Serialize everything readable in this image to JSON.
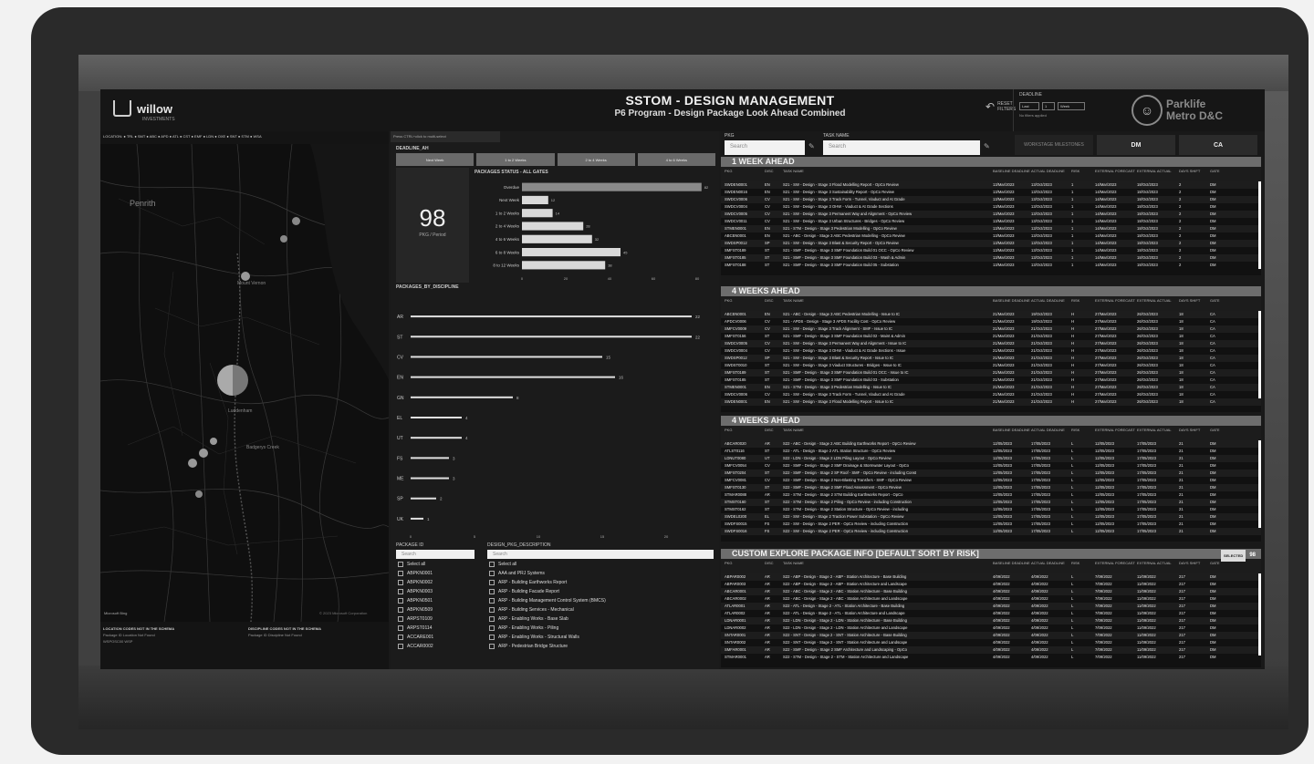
{
  "header": {
    "logo_text": "willow",
    "logo_sub": "INVESTMENTS",
    "title": "SSTOM - DESIGN MANAGEMENT",
    "subtitle": "P6 Program - Design Package Look Ahead Combined",
    "reset_label": "RESET FILTERS",
    "deadline_label": "DEADLINE",
    "deadline_opts": [
      "Last",
      "1",
      "Week"
    ],
    "no_filter_label": "No filters applied",
    "brand_line1": "Parklife",
    "brand_line2": "Metro D&C"
  },
  "map": {
    "legend": "LOCATION: ● TRL ● SMT ● ABC ● APD ● ATL ● CST ● EMF ● LDN ● OXE ● SNT ● STM ● WSA",
    "place1": "Penrith",
    "place2": "Luddenham",
    "place3": "Mount Vernon",
    "place4": "Badgerys Creek",
    "attribution": "© 2023 Microsoft Corporation",
    "bing": "Microsoft Bing",
    "bottom_left_title": "LOCATION CODES NOT IN THE SCHEMA",
    "bottom_left_row": "Package ID    Location Not Found",
    "bottom_left_row2": "WSPOSC00    WSP",
    "bottom_right_title": "DISCIPLINE CODES NOT IN THE SCHEMA",
    "bottom_right_row": "Package ID    Discipline Not Found"
  },
  "mid": {
    "tab": "Press CTRL+click to multi-select",
    "deadline_title": "DEADLINE_AH",
    "tabs": [
      "Next Week",
      "1 to 2 Weeks",
      "2 to 4 Weeks",
      "4 to 6 Weeks"
    ],
    "kpi_value": "98",
    "kpi_label": "PKG / Period",
    "status_title": "PACKAGES STATUS - ALL GATES",
    "discipline_title": "PACKAGES_BY_DISCIPLINE",
    "pkg_col_title": "PACKAGE ID",
    "desc_col_title": "DESIGN_PKG_DESCRIPTION",
    "search_placeholder": "Search",
    "pkg_ids": [
      "Select all",
      "ABPKN0001",
      "ABPKN0002",
      "ABPKN0003",
      "ABPKN0501",
      "ABPKN0509",
      "ARPST0109",
      "ARPST0114",
      "ACCARE001",
      "ACCAR0002"
    ],
    "pkg_desc": [
      "Select all",
      "AAA and PRJ Systems",
      "ARP - Building Earthworks Report",
      "ARP - Building Facade Report",
      "ARP - Building Management Control System (BMCS)",
      "ARP - Building Services - Mechanical",
      "ARP - Enabling Works - Base Slab",
      "ARP - Enabling Works - Piling",
      "ARP - Enabling Works - Structural Walls",
      "ARP - Pedestrian Bridge Structure"
    ]
  },
  "chart_data": [
    {
      "type": "bar",
      "title": "PACKAGES STATUS - ALL GATES",
      "orientation": "horizontal",
      "categories": [
        "Overdue",
        "Next Week",
        "1 to 2 Weeks",
        "2 to 4 Weeks",
        "4 to 6 Weeks",
        "6 to 8 Weeks",
        "8 to 12 Weeks"
      ],
      "values": [
        82,
        12,
        14,
        28,
        32,
        45,
        38
      ],
      "xticks": [
        0,
        20,
        40,
        60,
        80
      ],
      "xlim": [
        0,
        85
      ]
    },
    {
      "type": "bar",
      "title": "PACKAGES_BY_DISCIPLINE",
      "orientation": "horizontal",
      "categories": [
        "AR",
        "ST",
        "CV",
        "EN",
        "GN",
        "EL",
        "UT",
        "FS",
        "ME",
        "SP",
        "UK"
      ],
      "values": [
        22,
        22,
        15,
        16,
        8,
        4,
        4,
        3,
        3,
        2,
        1
      ],
      "xticks": [
        0,
        5,
        10,
        15,
        20
      ],
      "xlim": [
        0,
        22
      ]
    }
  ],
  "right": {
    "pkg_label": "PKG",
    "task_label": "TASK NAME",
    "search_placeholder": "Search",
    "toggle_off": "WORKSTAGE MILESTONES",
    "toggle_dm": "DM",
    "toggle_ca": "CA",
    "columns": [
      "PKG",
      "DISC",
      "TASK NAME",
      "BASELINE DEADLINE",
      "ACTUAL DEADLINE",
      "RISK",
      "EXTERNAL FORECAST",
      "EXTERNAL ACTUAL",
      "DAYS SHIFT",
      "GATE"
    ],
    "tables": [
      {
        "title": "1 WEEK AHEAD",
        "rows": [
          [
            "SWDEN0001",
            "EN",
            "S21 - SW - Design - Stage 3 Flood Modelling Report - OpCo Review",
            "13/Mar/2023",
            "13/Oct/2023",
            "1",
            "14/Mar/2023",
            "18/Oct/2023",
            "2",
            "DM"
          ],
          [
            "SWDEN0016",
            "EN",
            "S21 - SW - Design - Stage 3 Sustainability Report - OpCo Review",
            "13/Mar/2023",
            "13/Oct/2023",
            "1",
            "14/Mar/2023",
            "18/Oct/2023",
            "2",
            "DM"
          ],
          [
            "SWDCV0006",
            "CV",
            "S21 - SW - Design - Stage 3 Track Form - Tunnel, Viaduct and At Grade",
            "13/Mar/2023",
            "13/Oct/2023",
            "1",
            "14/Mar/2023",
            "18/Oct/2023",
            "2",
            "DM"
          ],
          [
            "SWDCV0004",
            "CV",
            "S21 - SW - Design - Stage 3 OHW - Viaduct & At Grade Sections",
            "13/Mar/2023",
            "13/Oct/2023",
            "1",
            "14/Mar/2023",
            "18/Oct/2023",
            "2",
            "DM"
          ],
          [
            "SWDCV0005",
            "CV",
            "S21 - SW - Design - Stage 3 Permanent Way and Alignment - OpCo Review",
            "13/Mar/2023",
            "13/Oct/2023",
            "1",
            "14/Mar/2023",
            "18/Oct/2023",
            "2",
            "DM"
          ],
          [
            "SWDCV0011",
            "CV",
            "S21 - SW - Design - Stage 3 Urban Structures - Bridges - OpCo Review",
            "13/Mar/2023",
            "13/Oct/2023",
            "1",
            "14/Mar/2023",
            "18/Oct/2023",
            "2",
            "DM"
          ],
          [
            "STMEN0001",
            "EN",
            "S21 - STM - Design - Stage 3 Pedestrian Modelling - OpCo Review",
            "13/Mar/2023",
            "13/Oct/2023",
            "1",
            "14/Mar/2023",
            "18/Oct/2023",
            "2",
            "DM"
          ],
          [
            "ABCEN0001",
            "EN",
            "S21 - ABC - Design - Stage 3 ABC Pedestrian Modelling - OpCo Review",
            "13/Mar/2023",
            "13/Oct/2023",
            "1",
            "14/Mar/2023",
            "18/Oct/2023",
            "2",
            "DM"
          ],
          [
            "SWDSP0012",
            "SP",
            "S21 - SW - Design - Stage 3 Blast & Security Report - OpCo Review",
            "13/Mar/2023",
            "13/Oct/2023",
            "1",
            "14/Mar/2023",
            "18/Oct/2023",
            "2",
            "DM"
          ],
          [
            "SMFST0189",
            "ST",
            "S21 - SMF - Design - Stage 3 SMF Foundation Build 01 OCC - OpCo Review",
            "13/Mar/2023",
            "13/Oct/2023",
            "1",
            "14/Mar/2023",
            "18/Oct/2023",
            "2",
            "DM"
          ],
          [
            "SMFST0185",
            "ST",
            "S21 - SMF - Design - Stage 3 SMF Foundation Build 03 - Wash & Admin",
            "13/Mar/2023",
            "13/Oct/2023",
            "1",
            "14/Mar/2023",
            "18/Oct/2023",
            "2",
            "DM"
          ],
          [
            "SMFST0188",
            "ST",
            "S21 - SMF - Design - Stage 3 SMF Foundation Build 05 - Substation",
            "13/Mar/2023",
            "13/Oct/2023",
            "1",
            "14/Mar/2023",
            "18/Oct/2023",
            "2",
            "DM"
          ]
        ]
      },
      {
        "title": "4 WEEKS AHEAD",
        "rows": [
          [
            "ABCEN0001",
            "EN",
            "S21 - ABC - Design - Stage 3 ABC Pedestrian Modelling - Issue to IC",
            "21/Mar/2023",
            "19/Oct/2023",
            "H",
            "27/Mar/2023",
            "26/Oct/2023",
            "18",
            "CA"
          ],
          [
            "APDCV0006",
            "CV",
            "S21 - APDS - Design - Stage 3 APDS Facility Cost - OpCo Review",
            "21/Mar/2023",
            "19/Oct/2023",
            "H",
            "27/Mar/2023",
            "26/Oct/2023",
            "18",
            "CA"
          ],
          [
            "SMFCV0009",
            "CV",
            "S21 - SW - Design - Stage 3 Track Alignment - SMF - Issue to IC",
            "21/Mar/2023",
            "21/Oct/2023",
            "H",
            "27/Mar/2023",
            "26/Oct/2023",
            "18",
            "CA"
          ],
          [
            "SMFST0156",
            "ST",
            "S21 - SMF - Design - Stage 3 SMF Foundation Build 02 - Maint & Admin",
            "21/Mar/2023",
            "21/Oct/2023",
            "H",
            "27/Mar/2023",
            "26/Oct/2023",
            "18",
            "CA"
          ],
          [
            "SWDCV0005",
            "CV",
            "S21 - SW - Design - Stage 3 Permanent Way and Alignment - Issue to IC",
            "21/Mar/2023",
            "21/Oct/2023",
            "H",
            "27/Mar/2023",
            "26/Oct/2023",
            "18",
            "CA"
          ],
          [
            "SWDCV0004",
            "CV",
            "S21 - SW - Design - Stage 3 OHW - Viaduct & At Grade Sections - Issue",
            "21/Mar/2023",
            "21/Oct/2023",
            "H",
            "27/Mar/2023",
            "26/Oct/2023",
            "18",
            "CA"
          ],
          [
            "SWDSP0012",
            "SP",
            "S21 - SW - Design - Stage 3 Blast & Security Report - Issue to IC",
            "21/Mar/2023",
            "21/Oct/2023",
            "H",
            "27/Mar/2023",
            "26/Oct/2023",
            "18",
            "CA"
          ],
          [
            "SWDST0010",
            "ST",
            "S21 - SW - Design - Stage 3 Viaduct Structures - Bridges - Issue to IC",
            "21/Mar/2023",
            "21/Oct/2023",
            "H",
            "27/Mar/2023",
            "26/Oct/2023",
            "18",
            "CA"
          ],
          [
            "SMFST0189",
            "ST",
            "S21 - SMF - Design - Stage 3 SMF Foundation Build 01 OCC - Issue to IC",
            "21/Mar/2023",
            "21/Oct/2023",
            "H",
            "27/Mar/2023",
            "26/Oct/2023",
            "18",
            "CA"
          ],
          [
            "SMFST0185",
            "ST",
            "S21 - SMF - Design - Stage 3 SMF Foundation Build 03 - Substation",
            "21/Mar/2023",
            "21/Oct/2023",
            "H",
            "27/Mar/2023",
            "26/Oct/2023",
            "18",
            "CA"
          ],
          [
            "STMEN0001",
            "EN",
            "S21 - STM - Design - Stage 3 Pedestrian Modelling - Issue to IC",
            "21/Mar/2023",
            "21/Oct/2023",
            "H",
            "27/Mar/2023",
            "26/Oct/2023",
            "18",
            "CA"
          ],
          [
            "SWDCV0006",
            "CV",
            "S21 - SW - Design - Stage 3 Track Form - Tunnel, Viaduct and At Grade",
            "21/Mar/2023",
            "21/Oct/2023",
            "H",
            "27/Mar/2023",
            "26/Oct/2023",
            "18",
            "CA"
          ],
          [
            "SWDEN0001",
            "EN",
            "S21 - SW - Design - Stage 3 Flood Modelling Report - Issue to IC",
            "21/Mar/2023",
            "21/Oct/2023",
            "H",
            "27/Mar/2023",
            "26/Oct/2023",
            "18",
            "CA"
          ]
        ]
      },
      {
        "title": "4 WEEKS AHEAD",
        "rows": [
          [
            "ABCAR0020",
            "AR",
            "S22 - ABC - Design - Stage 2 ABC Building Earthworks Report - OpCo Review",
            "12/05/2023",
            "17/05/2023",
            "L",
            "12/05/2023",
            "17/05/2023",
            "21",
            "DM"
          ],
          [
            "ATLST0116",
            "ST",
            "S22 - ATL - Design - Stage 2 ATL Station Structure - OpCo Review",
            "12/05/2023",
            "17/05/2023",
            "L",
            "12/05/2023",
            "17/05/2023",
            "21",
            "DM"
          ],
          [
            "LDNUT0080",
            "UT",
            "S22 - LDN - Design - Stage 2 LDN Piling Layout - OpCo Review",
            "12/05/2023",
            "17/05/2023",
            "L",
            "12/05/2023",
            "17/05/2023",
            "21",
            "DM"
          ],
          [
            "SMFCV0054",
            "CV",
            "S22 - SMF - Design - Stage 2 SMF Drainage & Stormwater Layout - OpCo",
            "12/05/2023",
            "17/05/2023",
            "L",
            "12/05/2023",
            "17/05/2023",
            "21",
            "DM"
          ],
          [
            "SMFST0204",
            "ST",
            "S22 - SMF - Design - Stage 2 SP Roof - SMF - OpCo Review - including Const",
            "12/05/2023",
            "17/05/2023",
            "L",
            "12/05/2023",
            "17/05/2023",
            "21",
            "DM"
          ],
          [
            "SMFCV0081",
            "CV",
            "S22 - SMF - Design - Stage 2 Non-Blasting Transfers - SMF - OpCo Review",
            "12/05/2023",
            "17/05/2023",
            "L",
            "12/05/2023",
            "17/05/2023",
            "21",
            "DM"
          ],
          [
            "SMFST0130",
            "ST",
            "S22 - SMF - Design - Stage 2 SMF Flood Assessment - OpCo Review",
            "12/05/2023",
            "17/05/2023",
            "L",
            "12/05/2023",
            "17/05/2023",
            "21",
            "DM"
          ],
          [
            "STMAR0088",
            "AR",
            "S22 - STM - Design - Stage 2 STM Building Earthworks Report - OpCo",
            "12/05/2023",
            "17/05/2023",
            "L",
            "12/05/2023",
            "17/05/2023",
            "21",
            "DM"
          ],
          [
            "STMST0160",
            "ST",
            "S22 - STM - Design - Stage 2 Piling - OpCo Review - including Construction",
            "12/05/2023",
            "17/05/2023",
            "L",
            "12/05/2023",
            "17/05/2023",
            "21",
            "DM"
          ],
          [
            "STMST0162",
            "ST",
            "S22 - STM - Design - Stage 2 Station Structure - OpCo Review - including",
            "12/05/2023",
            "17/05/2023",
            "L",
            "12/05/2023",
            "17/05/2023",
            "21",
            "DM"
          ],
          [
            "SWDEL0200",
            "EL",
            "S22 - SW - Design - Stage 2 Traction Power Substation - OpCo Review",
            "12/05/2023",
            "17/05/2023",
            "L",
            "12/05/2023",
            "17/05/2023",
            "21",
            "DM"
          ],
          [
            "SWDFS0015",
            "FS",
            "S22 - SW - Design - Stage 2 PER - OpCo Review - including Construction",
            "12/05/2023",
            "17/05/2023",
            "L",
            "12/05/2023",
            "17/05/2023",
            "21",
            "DM"
          ],
          [
            "SWDFS0016",
            "FS",
            "S22 - SW - Design - Stage 2 PER - OpCo Review - including Construction",
            "12/05/2023",
            "17/05/2023",
            "L",
            "12/05/2023",
            "17/05/2023",
            "21",
            "DM"
          ]
        ]
      },
      {
        "title": "CUSTOM EXPLORE PACKAGE INFO [DEFAULT SORT BY RISK]",
        "extra_btn": "SELECTED",
        "extra_num": "98",
        "rows": [
          [
            "ABPAR0002",
            "AR",
            "S22 - ABP - Design - Stage 2 - ABP - Station Architecture - Base Building",
            "4/09/2022",
            "4/09/2022",
            "L",
            "7/09/2022",
            "11/09/2022",
            "217",
            "DM"
          ],
          [
            "ABPAR0003",
            "AR",
            "S22 - ABP - Design - Stage 2 - ABP - Station Architecture and Landscape",
            "4/09/2022",
            "4/09/2022",
            "L",
            "7/09/2022",
            "11/09/2022",
            "217",
            "DM"
          ],
          [
            "ABCAR0001",
            "AR",
            "S22 - ABC - Design - Stage 2 - ABC - Station Architecture - Base Building",
            "4/09/2022",
            "4/09/2022",
            "L",
            "7/09/2022",
            "11/09/2022",
            "217",
            "DM"
          ],
          [
            "ABCAR0002",
            "AR",
            "S22 - ABC - Design - Stage 2 - ABC - Station Architecture and Landscape",
            "4/09/2022",
            "4/09/2022",
            "L",
            "7/09/2022",
            "11/09/2022",
            "217",
            "DM"
          ],
          [
            "ATLAR0001",
            "AR",
            "S22 - ATL - Design - Stage 2 - ATL - Station Architecture - Base Building",
            "4/09/2022",
            "4/09/2022",
            "L",
            "7/09/2022",
            "11/09/2022",
            "217",
            "DM"
          ],
          [
            "ATLAR0002",
            "AR",
            "S22 - ATL - Design - Stage 2 - ATL - Station Architecture and Landscape",
            "4/09/2022",
            "4/09/2022",
            "L",
            "7/09/2022",
            "11/09/2022",
            "217",
            "DM"
          ],
          [
            "LDNAR0001",
            "AR",
            "S22 - LDN - Design - Stage 2 - LDN - Station Architecture - Base Building",
            "4/09/2022",
            "4/09/2022",
            "L",
            "7/09/2022",
            "11/09/2022",
            "217",
            "DM"
          ],
          [
            "LDNAR0002",
            "AR",
            "S22 - LDN - Design - Stage 2 - LDN - Station Architecture and Landscape",
            "4/09/2022",
            "4/09/2022",
            "L",
            "7/09/2022",
            "11/09/2022",
            "217",
            "DM"
          ],
          [
            "SNTAR0001",
            "AR",
            "S22 - SNT - Design - Stage 2 - SNT - Station Architecture - Base Building",
            "4/09/2022",
            "4/09/2022",
            "L",
            "7/09/2022",
            "11/09/2022",
            "217",
            "DM"
          ],
          [
            "SNTAR0002",
            "AR",
            "S22 - SNT - Design - Stage 2 - SNT - Station Architecture and Landscape",
            "4/09/2022",
            "4/09/2022",
            "L",
            "7/09/2022",
            "11/09/2022",
            "217",
            "DM"
          ],
          [
            "SMFAR0001",
            "AR",
            "S22 - SMF - Design - Stage 2 SMF Architecture and Landscaping - OpCo",
            "4/09/2022",
            "4/09/2022",
            "L",
            "7/09/2022",
            "11/09/2022",
            "217",
            "DM"
          ],
          [
            "STMAR0001",
            "AR",
            "S22 - STM - Design - Stage 2 - STM - Station Architecture and Landscape",
            "4/09/2022",
            "4/09/2022",
            "L",
            "7/09/2022",
            "11/09/2022",
            "217",
            "DM"
          ]
        ]
      }
    ]
  }
}
